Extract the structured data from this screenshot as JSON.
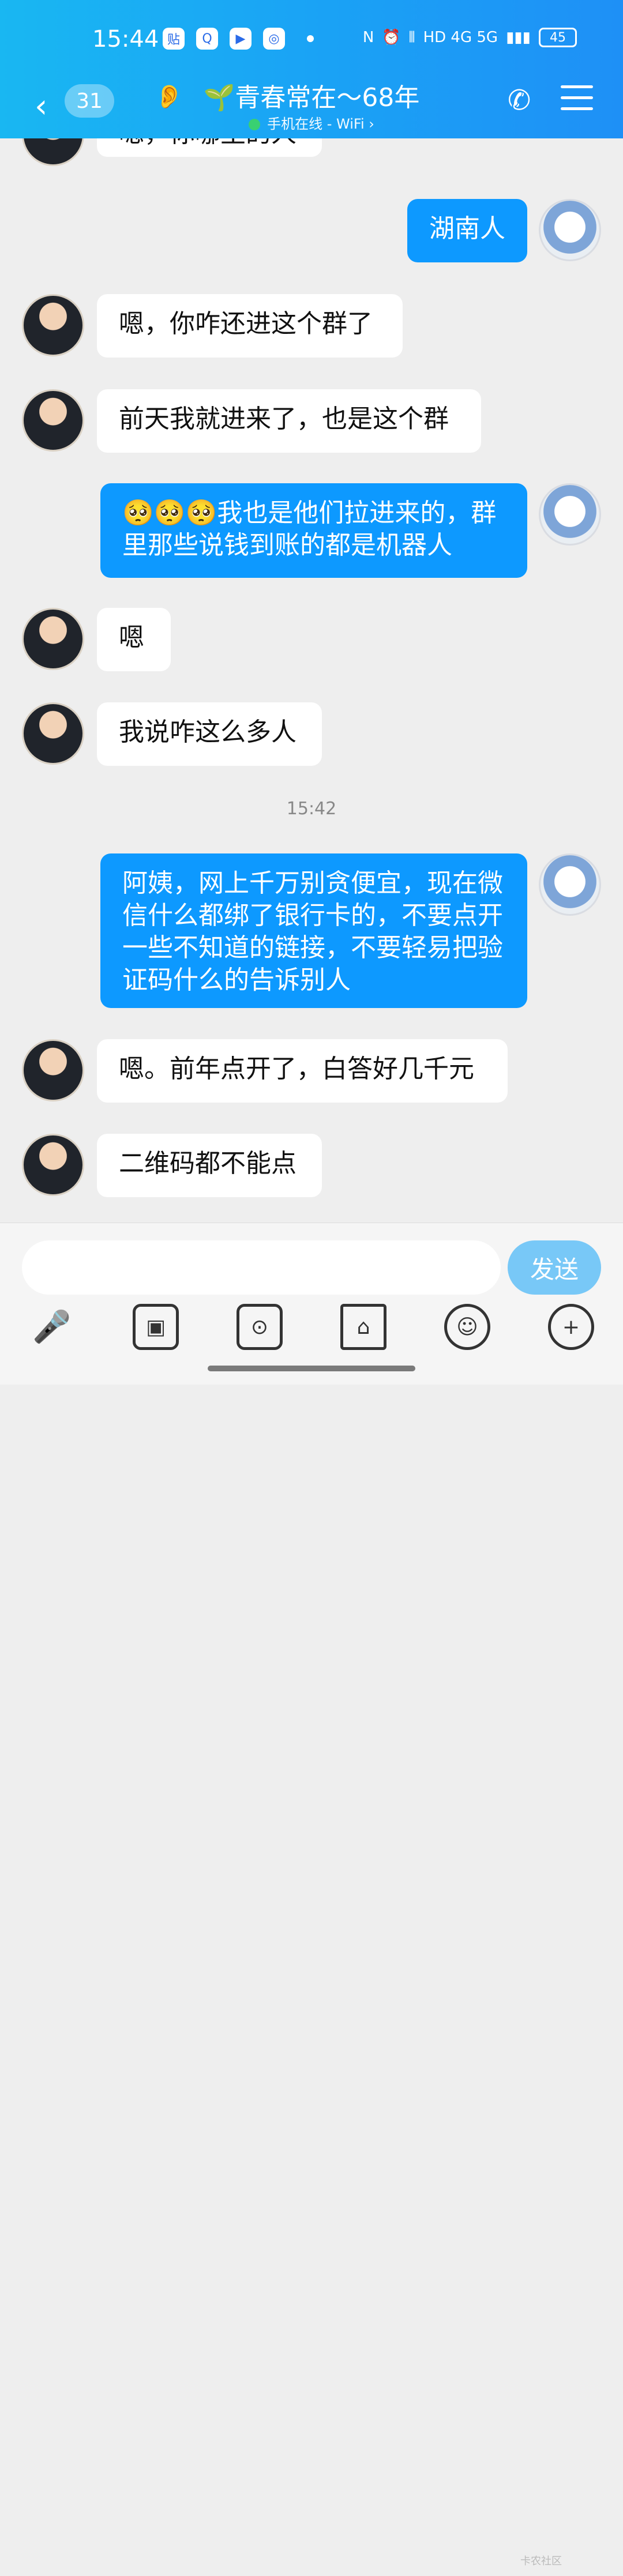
{
  "status_bar": {
    "time": "15:44",
    "apps": [
      "贴",
      "Q",
      "▶",
      "◎"
    ],
    "network": "HD 4G 5G",
    "battery": "45"
  },
  "header": {
    "back_symbol": "‹",
    "unread_count": "31",
    "title": "🌱青春常在～68年",
    "subtitle": "手机在线 - WiFi ›"
  },
  "messages": [
    {
      "side": "left",
      "text": "嗯，你哪里的人",
      "cut_off": true
    },
    {
      "side": "right",
      "text": "湖南人"
    },
    {
      "side": "left",
      "text": "嗯，你咋还进这个群了"
    },
    {
      "side": "left",
      "text": "前天我就进来了，也是这个群"
    },
    {
      "side": "right",
      "text": "🥺🥺🥺我也是他们拉进来的，群里那些说钱到账的都是机器人"
    },
    {
      "side": "left",
      "text": "嗯"
    },
    {
      "side": "left",
      "text": "我说咋这么多人"
    },
    {
      "side": "right",
      "text": "阿姨，网上千万别贪便宜，现在微信什么都绑了银行卡的，不要点开一些不知道的链接，不要轻易把验证码什么的告诉别人"
    },
    {
      "side": "left",
      "text": "嗯。前年点开了，白答好几千元"
    },
    {
      "side": "left",
      "text": "二维码都不能点"
    }
  ],
  "timestamp": "15:42",
  "input": {
    "placeholder": "",
    "send_label": "发送"
  },
  "watermark": "卡农社区"
}
